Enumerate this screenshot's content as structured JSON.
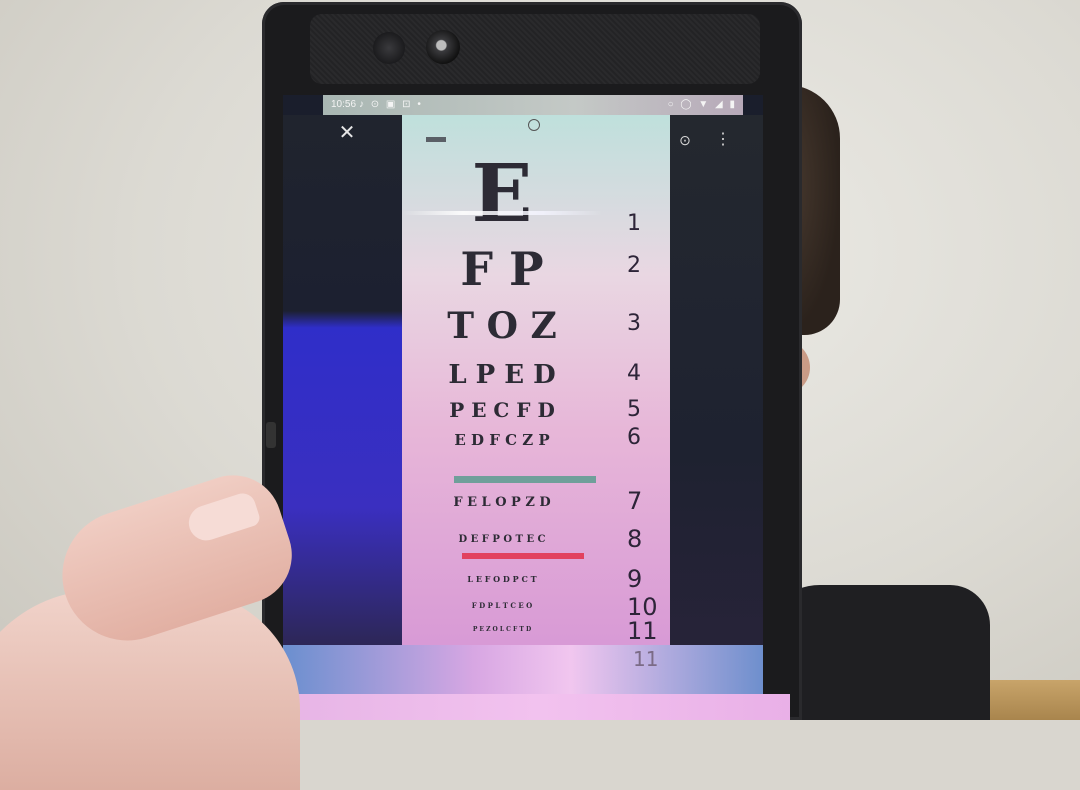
{
  "status_bar": {
    "time": "10:56",
    "icons_left": "♪ ⊙ ▣ ⊡ •",
    "icons_right": "○ ◯ ▼ ◢ ▮"
  },
  "viewer": {
    "close_icon": "close-icon",
    "zoom_icon": "zoom-icon",
    "menu_icon": "more-vert-icon"
  },
  "eye_chart": {
    "rows": [
      {
        "letters": "E",
        "number": "1"
      },
      {
        "letters": "F P",
        "number": "2"
      },
      {
        "letters": "T O Z",
        "number": "3"
      },
      {
        "letters": "L P E D",
        "number": "4"
      },
      {
        "letters": "P E C F D",
        "number": "5"
      },
      {
        "letters": "E D F C Z P",
        "number": "6"
      },
      {
        "letters": "F E L O P Z D",
        "number": "7"
      },
      {
        "letters": "D E F P O T E C",
        "number": "8"
      },
      {
        "letters": "L E F O D P C T",
        "number": "9"
      },
      {
        "letters": "F D P L T C E O",
        "number": "10"
      },
      {
        "letters": "P E Z O L C F T D",
        "number": "11"
      }
    ],
    "bottom_partial_number": "11",
    "line_colors": {
      "green": "#6f9f9a",
      "red": "#e2415f"
    }
  }
}
